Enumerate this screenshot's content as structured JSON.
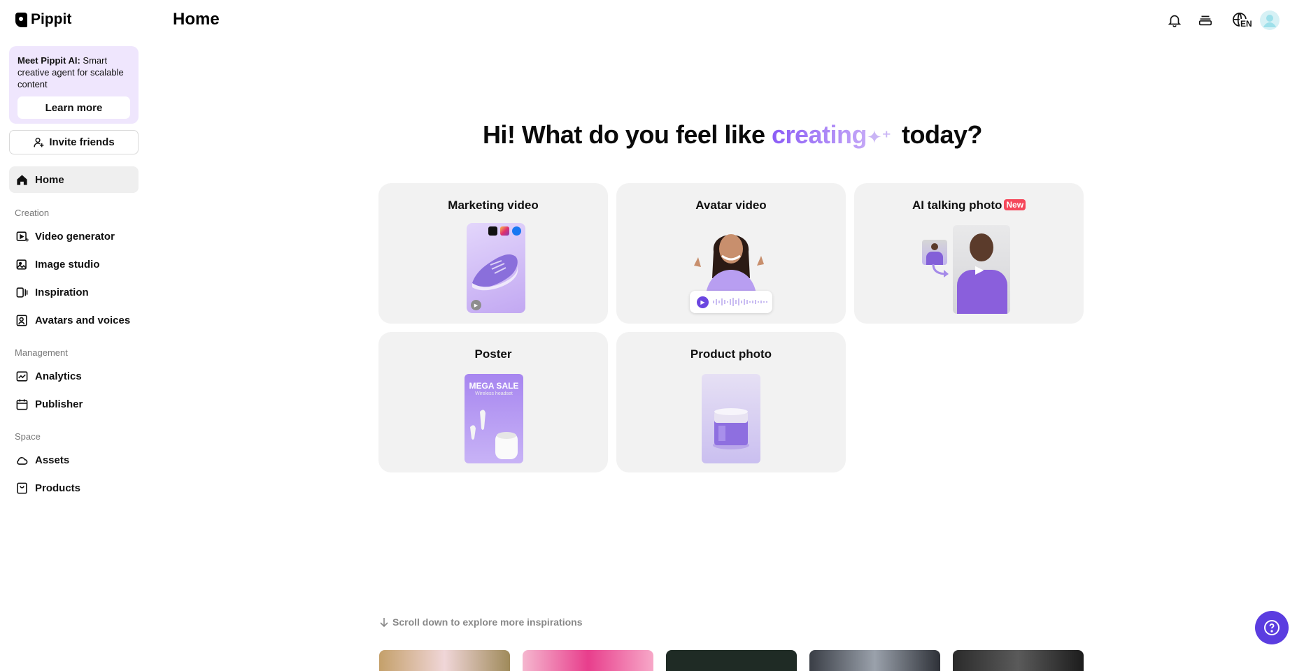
{
  "app": {
    "name": "Pippit"
  },
  "sidebar": {
    "promo": {
      "title_bold": "Meet Pippit AI:",
      "title_rest": " Smart creative agent for scalable content",
      "button": "Learn more"
    },
    "invite_label": "Invite friends",
    "home_label": "Home",
    "sections": [
      {
        "label": "Creation",
        "items": [
          "Video generator",
          "Image studio",
          "Inspiration",
          "Avatars and voices"
        ]
      },
      {
        "label": "Management",
        "items": [
          "Analytics",
          "Publisher"
        ]
      },
      {
        "label": "Space",
        "items": [
          "Assets",
          "Products"
        ]
      }
    ]
  },
  "header": {
    "title": "Home",
    "language": "EN",
    "icons": [
      "bell-icon",
      "layers-icon",
      "globe-icon",
      "avatar"
    ]
  },
  "hero": {
    "before": "Hi! What do you feel like ",
    "accent": "creating",
    "after": " today?"
  },
  "cards": [
    {
      "title": "Marketing video"
    },
    {
      "title": "Avatar video"
    },
    {
      "title": "AI talking photo",
      "badge": "New"
    },
    {
      "title": "Poster",
      "poster_title": "MEGA SALE",
      "poster_sub": "Wireless headset"
    },
    {
      "title": "Product photo"
    }
  ],
  "scroll_hint": "Scroll down to explore more inspirations",
  "colors": {
    "accent": "#8b5cf6",
    "help_button": "#5b3de0",
    "badge": "#f5485b",
    "promo_bg": "#efe6fd"
  }
}
